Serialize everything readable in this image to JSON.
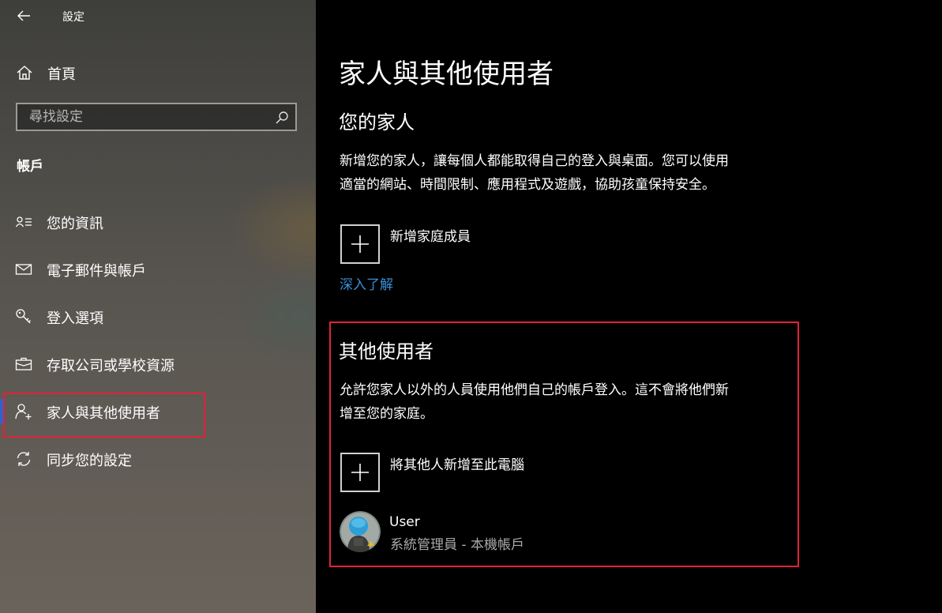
{
  "window": {
    "app_title": "設定"
  },
  "sidebar": {
    "home_label": "首頁",
    "search": {
      "placeholder": "尋找設定",
      "value": ""
    },
    "section_title": "帳戶",
    "items": [
      {
        "label": "您的資訊",
        "icon": "contact-info-icon"
      },
      {
        "label": "電子郵件與帳戶",
        "icon": "mail-icon"
      },
      {
        "label": "登入選項",
        "icon": "key-icon"
      },
      {
        "label": "存取公司或學校資源",
        "icon": "briefcase-icon"
      },
      {
        "label": "家人與其他使用者",
        "icon": "add-person-icon",
        "selected": true
      },
      {
        "label": "同步您的設定",
        "icon": "sync-icon"
      }
    ]
  },
  "main": {
    "title": "家人與其他使用者",
    "family": {
      "heading": "您的家人",
      "description_line1": "新增您的家人，讓每個人都能取得自己的登入與桌面。您可以使用",
      "description_line2": "適當的網站、時間限制、應用程式及遊戲，協助孩童保持安全。",
      "add_label": "新增家庭成員",
      "learn_more": "深入了解"
    },
    "others": {
      "heading": "其他使用者",
      "description_line1": "允許您家人以外的人員使用他們自己的帳戶登入。這不會將他們新",
      "description_line2": "增至您的家庭。",
      "add_label": "將其他人新增至此電腦",
      "user": {
        "name": "User",
        "meta": "系統管理員 - 本機帳戶"
      }
    }
  },
  "colors": {
    "accent": "#2a66c9",
    "link": "#3a8fd9",
    "highlight": "#e0223a"
  }
}
